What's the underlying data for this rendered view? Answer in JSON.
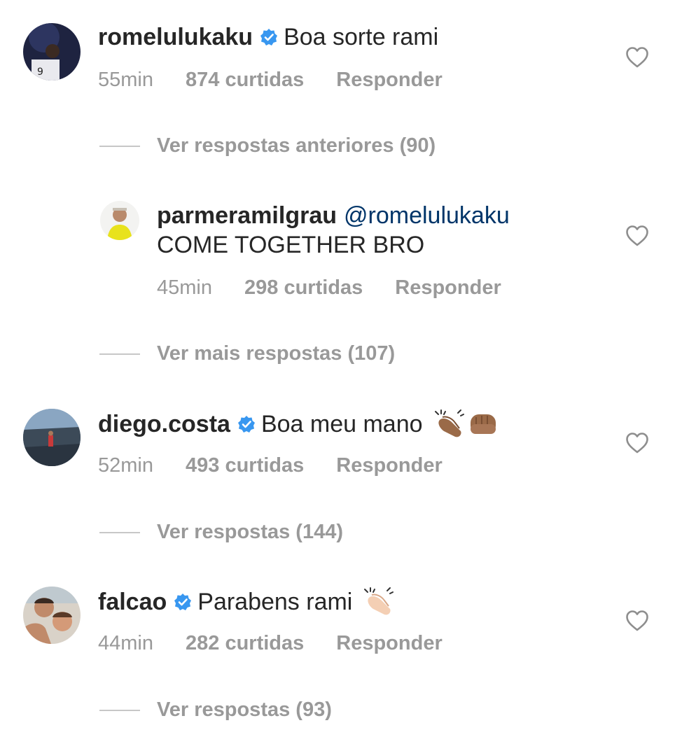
{
  "comments": [
    {
      "username": "romelulukaku",
      "text": "Boa sorte rami",
      "time": "55min",
      "likes": "874 curtidas",
      "reply": "Responder"
    },
    {
      "username": "parmeramilgrau",
      "mention": "@romelulukaku",
      "text": "COME TOGETHER BRO",
      "time": "45min",
      "likes": "298 curtidas",
      "reply": "Responder"
    },
    {
      "username": "diego.costa",
      "text": "Boa meu mano",
      "time": "52min",
      "likes": "493 curtidas",
      "reply": "Responder"
    },
    {
      "username": "falcao",
      "text": "Parabens rami",
      "time": "44min",
      "likes": "282 curtidas",
      "reply": "Responder"
    }
  ],
  "view_links": [
    "Ver respostas anteriores (90)",
    "Ver mais respostas (107)",
    "Ver respostas (144)",
    "Ver respostas (93)"
  ],
  "colors": {
    "verified": "#3897f0",
    "mention": "#003569",
    "muted": "#999999"
  },
  "icons": [
    "verified-badge-icon",
    "heart-icon",
    "clapping-hands-emoji",
    "fist-bump-emoji"
  ]
}
